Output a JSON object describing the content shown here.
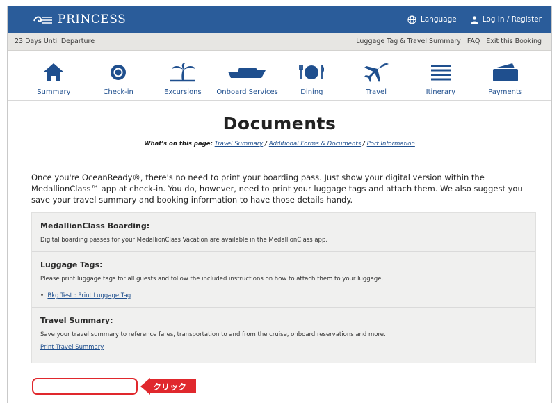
{
  "brand": {
    "name": "PRINCESS"
  },
  "topbar": {
    "language": "Language",
    "login": "Log In / Register"
  },
  "infobar": {
    "countdown": "23 Days Until Departure",
    "links": [
      "Luggage Tag & Travel Summary",
      "FAQ",
      "Exit this Booking"
    ]
  },
  "nav": [
    {
      "label": "Summary",
      "icon": "home-icon"
    },
    {
      "label": "Check-in",
      "icon": "medallion-icon"
    },
    {
      "label": "Excursions",
      "icon": "palm-tree-icon"
    },
    {
      "label": "Onboard Services",
      "icon": "ship-icon"
    },
    {
      "label": "Dining",
      "icon": "dining-icon"
    },
    {
      "label": "Travel",
      "icon": "airplane-icon"
    },
    {
      "label": "Itinerary",
      "icon": "list-icon"
    },
    {
      "label": "Payments",
      "icon": "wallet-icon"
    }
  ],
  "page": {
    "title": "Documents",
    "on_page_label": "What's on this page:",
    "on_page_links": [
      "Travel Summary",
      "Additional Forms & Documents",
      "Port Information"
    ],
    "intro": "Once you're OceanReady®, there's no need to print your boarding pass. Just show your digital version within the MedallionClass™ app at check-in. You do, however, need to print your luggage tags and attach them. We also suggest you save your travel summary and booking information to have those details handy."
  },
  "sections": {
    "boarding": {
      "title": "MedallionClass Boarding:",
      "text": "Digital boarding passes for your MedallionClass Vacation are available in the MedallionClass app."
    },
    "luggage": {
      "title": "Luggage Tags:",
      "text": "Please print luggage tags for all guests and follow the included instructions on how to attach them to your luggage.",
      "link": "Bkg Test : Print Luggage Tag"
    },
    "summary": {
      "title": "Travel Summary:",
      "text": "Save your travel summary to reference fares, transportation to and from the cruise, onboard reservations and more.",
      "link": "Print Travel Summary"
    }
  },
  "annotation": {
    "label": "クリック"
  },
  "colors": {
    "brand_blue": "#2a5c9a",
    "nav_blue": "#1f4f8e",
    "callout_red": "#e0282d"
  }
}
